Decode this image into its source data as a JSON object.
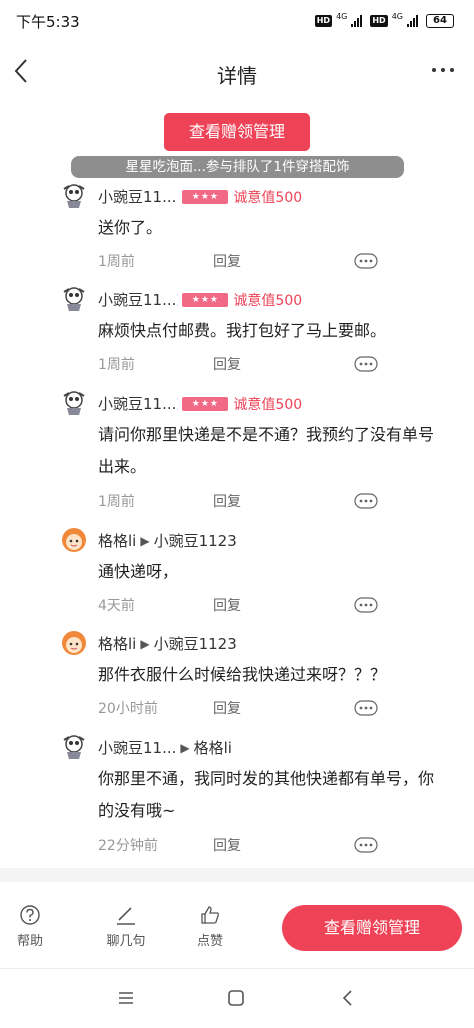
{
  "status_bar": {
    "time": "下午5:33",
    "hd1": "HD",
    "gen1": "4G",
    "hd2": "HD",
    "gen2": "4G",
    "battery": "64"
  },
  "header": {
    "title": "详情"
  },
  "top_button": "查看赠领管理",
  "banner": "星星吃泡面...参与排队了1件穿搭配饰",
  "reply_label": "回复",
  "comments": [
    {
      "author": "小豌豆11...",
      "stars": "★★★",
      "credit": "诚意值500",
      "text": "送你了。",
      "time": "1周前"
    },
    {
      "author": "小豌豆11...",
      "stars": "★★★",
      "credit": "诚意值500",
      "text": "麻烦快点付邮费。我打包好了马上要邮。",
      "time": "1周前"
    },
    {
      "author": "小豌豆11...",
      "stars": "★★★",
      "credit": "诚意值500",
      "text": "请问你那里快递是不是不通？我预约了没有单号出来。",
      "time": "1周前"
    },
    {
      "author": "格格li",
      "target": "小豌豆1123",
      "text": "通快递呀，",
      "time": "4天前"
    },
    {
      "author": "格格li",
      "target": "小豌豆1123",
      "text": "那件衣服什么时候给我快递过来呀？？？",
      "time": "20小时前"
    },
    {
      "author": "小豌豆11...",
      "target": "格格li",
      "text": "你那里不通，我同时发的其他快递都有单号，你的没有哦~",
      "time": "22分钟前"
    }
  ],
  "bottom_bar": {
    "help": "帮助",
    "chat": "聊几句",
    "like": "点赞",
    "action": "查看赠领管理"
  },
  "colors": {
    "accent": "#ee4256",
    "banner": "#8e8e8e",
    "star_badge": "#f06a86"
  }
}
